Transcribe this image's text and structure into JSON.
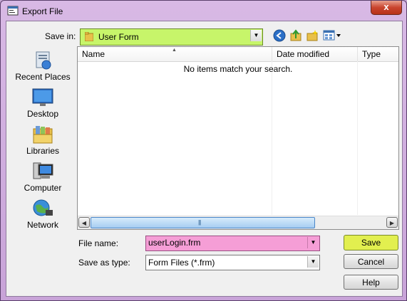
{
  "window": {
    "title": "Export File",
    "close_label": "x"
  },
  "toolbar": {
    "save_in_label": "Save in:",
    "save_in_value": "User Form"
  },
  "places": [
    {
      "label": "Recent Places"
    },
    {
      "label": "Desktop"
    },
    {
      "label": "Libraries"
    },
    {
      "label": "Computer"
    },
    {
      "label": "Network"
    }
  ],
  "list": {
    "columns": [
      "Name",
      "Date modified",
      "Type"
    ],
    "empty_message": "No items match your search."
  },
  "form": {
    "file_name_label": "File name:",
    "file_name_value": "userLogin.frm",
    "save_as_type_label": "Save as type:",
    "save_as_type_value": "Form Files (*.frm)"
  },
  "buttons": {
    "save": "Save",
    "cancel": "Cancel",
    "help": "Help"
  }
}
